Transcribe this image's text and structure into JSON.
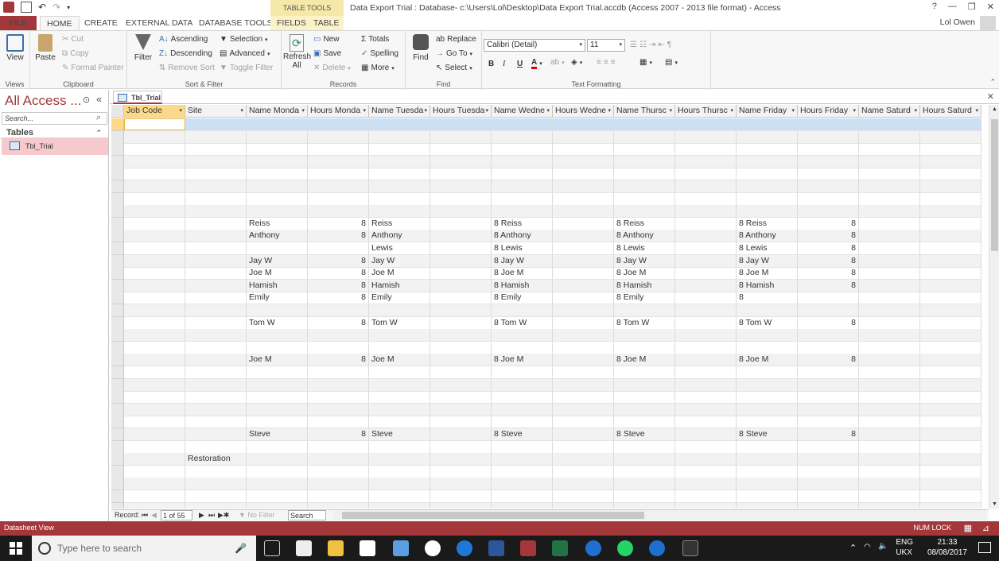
{
  "window": {
    "title": "Data Export Trial : Database- c:\\Users\\Lol\\Desktop\\Data Export Trial.accdb (Access 2007 - 2013 file format) - Access",
    "table_tools": "TABLE TOOLS",
    "help": "?",
    "user": "Lol Owen"
  },
  "tabs": [
    "HOME",
    "CREATE",
    "EXTERNAL DATA",
    "DATABASE TOOLS"
  ],
  "file_tab": "FILE",
  "tool_tabs": [
    "FIELDS",
    "TABLE"
  ],
  "ribbon": {
    "views": {
      "view": "View",
      "group": "Views"
    },
    "clipboard": {
      "paste": "Paste",
      "cut": "Cut",
      "copy": "Copy",
      "format_painter": "Format Painter",
      "group": "Clipboard"
    },
    "sort": {
      "filter": "Filter",
      "ascending": "Ascending",
      "descending": "Descending",
      "remove_sort": "Remove Sort",
      "selection": "Selection",
      "advanced": "Advanced",
      "toggle_filter": "Toggle Filter",
      "group": "Sort & Filter"
    },
    "records": {
      "refresh": "Refresh",
      "refresh2": "All",
      "new": "New",
      "save": "Save",
      "delete": "Delete",
      "totals": "Totals",
      "spelling": "Spelling",
      "more": "More",
      "group": "Records"
    },
    "find": {
      "find": "Find",
      "replace": "Replace",
      "goto": "Go To",
      "select": "Select",
      "group": "Find"
    },
    "text": {
      "font": "Calibri (Detail)",
      "size": "11",
      "bold": "B",
      "italic": "I",
      "underline": "U",
      "group": "Text Formatting"
    }
  },
  "nav": {
    "title": "All Access ...",
    "search_placeholder": "Search...",
    "section": "Tables",
    "items": [
      "Tbl_Trial"
    ]
  },
  "doc_tab": "Tbl_Trial",
  "grid": {
    "columns": [
      "Job Code",
      "Site",
      "Name Monda",
      "Hours Monda",
      "Name Tuesda",
      "Hours Tuesda",
      "Name Wedne",
      "Hours Wedne",
      "Name Thursc",
      "Hours Thursc",
      "Name Friday",
      "Hours Friday",
      "Name Saturd",
      "Hours Saturd"
    ],
    "rows": [
      [
        "",
        "",
        "",
        "",
        "",
        "",
        "",
        "",
        "",
        "",
        "",
        "",
        "",
        ""
      ],
      [
        "",
        "",
        "",
        "",
        "",
        "",
        "",
        "",
        "",
        "",
        "",
        "",
        "",
        ""
      ],
      [
        "",
        "",
        "",
        "",
        "",
        "",
        "",
        "",
        "",
        "",
        "",
        "",
        "",
        ""
      ],
      [
        "",
        "",
        "",
        "",
        "",
        "",
        "",
        "",
        "",
        "",
        "",
        "",
        "",
        ""
      ],
      [
        "",
        "",
        "",
        "",
        "",
        "",
        "",
        "",
        "",
        "",
        "",
        "",
        "",
        ""
      ],
      [
        "",
        "",
        "",
        "",
        "",
        "",
        "",
        "",
        "",
        "",
        "",
        "",
        "",
        ""
      ],
      [
        "",
        "",
        "",
        "",
        "",
        "",
        "",
        "",
        "",
        "",
        "",
        "",
        "",
        ""
      ],
      [
        "",
        "",
        "",
        "",
        "",
        "",
        "",
        "",
        "",
        "",
        "",
        "",
        "",
        ""
      ],
      [
        "",
        "",
        "Reiss",
        "8",
        "Reiss",
        "",
        "8 Reiss",
        "",
        "8 Reiss",
        "",
        "8 Reiss",
        "8",
        "",
        ""
      ],
      [
        "",
        "",
        "Anthony",
        "8",
        "Anthony",
        "",
        "8 Anthony",
        "",
        "8 Anthony",
        "",
        "8 Anthony",
        "8",
        "",
        ""
      ],
      [
        "",
        "",
        "",
        "",
        "Lewis",
        "",
        "8 Lewis",
        "",
        "8 Lewis",
        "",
        "8 Lewis",
        "8",
        "",
        ""
      ],
      [
        "",
        "",
        "Jay W",
        "8",
        "Jay W",
        "",
        "8 Jay W",
        "",
        "8 Jay W",
        "",
        "8 Jay W",
        "8",
        "",
        ""
      ],
      [
        "",
        "",
        "Joe M",
        "8",
        "Joe M",
        "",
        "8 Joe M",
        "",
        "8 Joe M",
        "",
        "8 Joe M",
        "8",
        "",
        ""
      ],
      [
        "",
        "",
        "Hamish",
        "8",
        "Hamish",
        "",
        "8 Hamish",
        "",
        "8 Hamish",
        "",
        "8 Hamish",
        "8",
        "",
        ""
      ],
      [
        "",
        "",
        "Emily",
        "8",
        "Emily",
        "",
        "8 Emily",
        "",
        "8 Emily",
        "",
        "8",
        "",
        "",
        ""
      ],
      [
        "",
        "",
        "",
        "",
        "",
        "",
        "",
        "",
        "",
        "",
        "",
        "",
        "",
        ""
      ],
      [
        "",
        "",
        "Tom W",
        "8",
        "Tom W",
        "",
        "8 Tom W",
        "",
        "8 Tom W",
        "",
        "8 Tom W",
        "8",
        "",
        ""
      ],
      [
        "",
        "",
        "",
        "",
        "",
        "",
        "",
        "",
        "",
        "",
        "",
        "",
        "",
        ""
      ],
      [
        "",
        "",
        "",
        "",
        "",
        "",
        "",
        "",
        "",
        "",
        "",
        "",
        "",
        ""
      ],
      [
        "",
        "",
        "Joe M",
        "8",
        "Joe M",
        "",
        "8 Joe M",
        "",
        "8 Joe M",
        "",
        "8 Joe M",
        "8",
        "",
        ""
      ],
      [
        "",
        "",
        "",
        "",
        "",
        "",
        "",
        "",
        "",
        "",
        "",
        "",
        "",
        ""
      ],
      [
        "",
        "",
        "",
        "",
        "",
        "",
        "",
        "",
        "",
        "",
        "",
        "",
        "",
        ""
      ],
      [
        "",
        "",
        "",
        "",
        "",
        "",
        "",
        "",
        "",
        "",
        "",
        "",
        "",
        ""
      ],
      [
        "",
        "",
        "",
        "",
        "",
        "",
        "",
        "",
        "",
        "",
        "",
        "",
        "",
        ""
      ],
      [
        "",
        "",
        "",
        "",
        "",
        "",
        "",
        "",
        "",
        "",
        "",
        "",
        "",
        ""
      ],
      [
        "",
        "",
        "Steve",
        "8",
        "Steve",
        "",
        "8 Steve",
        "",
        "8 Steve",
        "",
        "8 Steve",
        "8",
        "",
        ""
      ],
      [
        "",
        "",
        "",
        "",
        "",
        "",
        "",
        "",
        "",
        "",
        "",
        "",
        "",
        ""
      ],
      [
        "",
        "Restoration",
        "",
        "",
        "",
        "",
        "",
        "",
        "",
        "",
        "",
        "",
        "",
        ""
      ],
      [
        "",
        "",
        "",
        "",
        "",
        "",
        "",
        "",
        "",
        "",
        "",
        "",
        "",
        ""
      ],
      [
        "",
        "",
        "",
        "",
        "",
        "",
        "",
        "",
        "",
        "",
        "",
        "",
        "",
        ""
      ],
      [
        "",
        "",
        "",
        "",
        "",
        "",
        "",
        "",
        "",
        "",
        "",
        "",
        "",
        ""
      ],
      [
        "",
        "",
        "",
        "",
        "",
        "",
        "",
        "",
        "",
        "",
        "",
        "",
        "",
        ""
      ]
    ]
  },
  "record_nav": {
    "label": "Record:",
    "current": "1 of 55",
    "no_filter": "No Filter",
    "search": "Search"
  },
  "status": {
    "left": "Datasheet View",
    "right": "NUM LOCK"
  },
  "taskbar": {
    "search_placeholder": "Type here to search",
    "lang1": "ENG",
    "lang2": "UKX",
    "time": "21:33",
    "date": "08/08/2017"
  },
  "colors": {
    "accent": "#a4373a",
    "header_sel": "#fbd989",
    "row_sel": "#cce0f5"
  }
}
